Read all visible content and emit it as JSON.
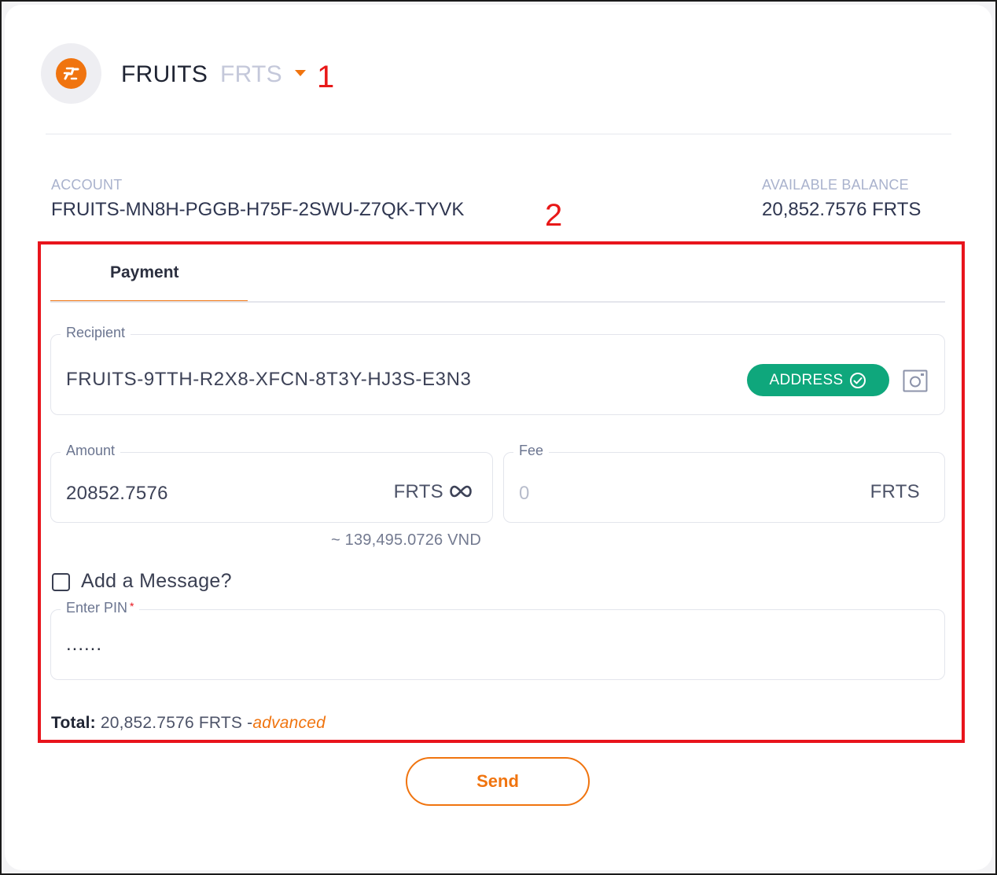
{
  "header": {
    "coin_name": "FRUITS",
    "coin_ticker": "FRTS",
    "logo_icon": "fruits-coin-logo-icon",
    "dropdown_icon": "caret-down-icon"
  },
  "annotations": {
    "marker_1": "1",
    "marker_2": "2"
  },
  "account": {
    "label": "ACCOUNT",
    "value": "FRUITS-MN8H-PGGB-H75F-2SWU-Z7QK-TYVK"
  },
  "balance": {
    "label": "AVAILABLE BALANCE",
    "value": "20,852.7576 FRTS"
  },
  "tabs": [
    {
      "label": "Payment",
      "active": true
    }
  ],
  "recipient": {
    "legend": "Recipient",
    "value": "FRUITS-9TTH-R2X8-XFCN-8T3Y-HJ3S-E3N3",
    "badge_label": "ADDRESS",
    "badge_icon": "check-circle-icon",
    "scan_icon": "qr-scan-icon"
  },
  "amount": {
    "legend": "Amount",
    "value": "20852.7576",
    "unit": "FRTS",
    "max_icon": "infinity-icon",
    "conversion": "~ 139,495.0726 VND"
  },
  "fee": {
    "legend": "Fee",
    "value": "0",
    "unit": "FRTS"
  },
  "message": {
    "label": "Add a Message?",
    "checked": false
  },
  "pin": {
    "legend": "Enter PIN",
    "required_mark": "*",
    "value": "......"
  },
  "total": {
    "key": "Total:",
    "value": "20,852.7576 FRTS -",
    "link": "advanced"
  },
  "send_button": {
    "label": "Send"
  },
  "colors": {
    "accent": "#f0740f",
    "success": "#0fa77c",
    "annotation": "#e8141c"
  }
}
